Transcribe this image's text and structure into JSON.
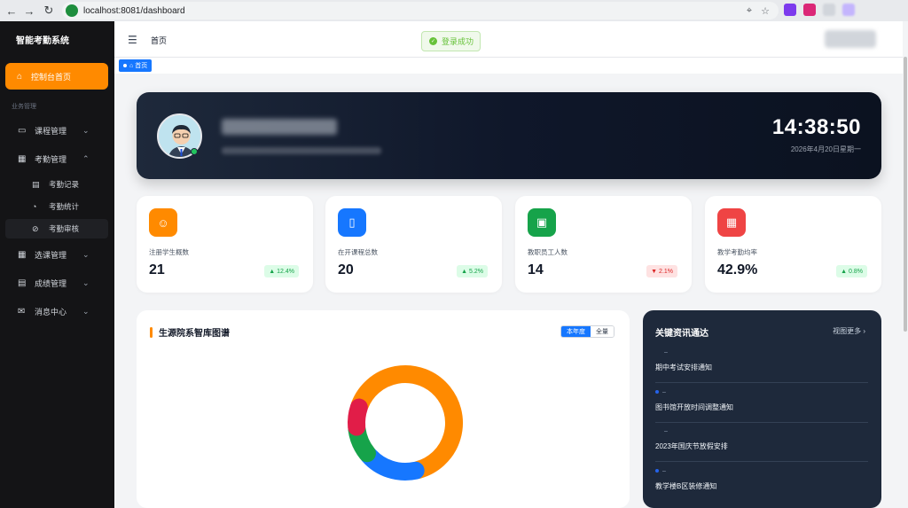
{
  "browser": {
    "url": "localhost:8081/dashboard"
  },
  "sidebar": {
    "brand": "智能考勤系统",
    "home_label": "控制台首页",
    "section_label": "业务管理",
    "items": [
      {
        "label": "课程管理",
        "icon": "book-icon"
      },
      {
        "label": "考勤管理",
        "icon": "calendar-icon"
      },
      {
        "label": "选课管理",
        "icon": "select-icon"
      },
      {
        "label": "成绩管理",
        "icon": "document-icon"
      },
      {
        "label": "消息中心",
        "icon": "mail-icon"
      }
    ],
    "sub_items": [
      {
        "label": "考勤记录",
        "icon": "file-icon"
      },
      {
        "label": "考勤统计",
        "icon": "pie-icon"
      },
      {
        "label": "考勤审核",
        "icon": "check-circle-icon"
      }
    ]
  },
  "header": {
    "breadcrumb": "首页",
    "toast": "登录成功",
    "tag": "首页"
  },
  "banner": {
    "time": "14:38:50",
    "date": "2026年4月20日星期一"
  },
  "stats": [
    {
      "label": "注册学生概数",
      "value": "21",
      "change": "▲ 12.4%",
      "trend": "up",
      "color": "#ff8a00",
      "icon": "user-icon"
    },
    {
      "label": "在开课程总数",
      "value": "20",
      "change": "▲ 5.2%",
      "trend": "up",
      "color": "#1677ff",
      "icon": "notebook-icon"
    },
    {
      "label": "教职员工人数",
      "value": "14",
      "change": "▼ 2.1%",
      "trend": "down",
      "color": "#16a34a",
      "icon": "staff-icon"
    },
    {
      "label": "教学考勤均率",
      "value": "42.9%",
      "change": "▲ 0.8%",
      "trend": "up",
      "color": "#ef4444",
      "icon": "calendar-icon"
    }
  ],
  "chart_panel": {
    "title": "生源院系智库图谱",
    "toggle": [
      "本年度",
      "全量"
    ],
    "active_toggle": 0
  },
  "chart_data": {
    "type": "pie",
    "variant": "donut",
    "values": [
      63,
      17,
      9,
      7
    ],
    "colors": [
      "#ff8a00",
      "#1677ff",
      "#16a34a",
      "#e11d48"
    ]
  },
  "news": {
    "title": "关键资讯通达",
    "more": "视图更多",
    "items": [
      {
        "dash": "–",
        "text": "期中考试安排通知",
        "highlight": false
      },
      {
        "dash": "–",
        "text": "图书馆开放时间调整通知",
        "highlight": true
      },
      {
        "dash": "–",
        "text": "2023年国庆节放假安排",
        "highlight": false
      },
      {
        "dash": "–",
        "text": "教学楼B区装修通知",
        "highlight": true
      }
    ]
  }
}
